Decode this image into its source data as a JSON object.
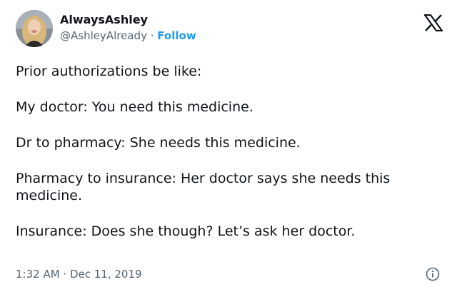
{
  "user": {
    "display_name": "AlwaysAshley",
    "handle": "@AshleyAlready",
    "separator": "·",
    "follow_label": "Follow"
  },
  "tweet": {
    "paragraphs": [
      "Prior authorizations be like:",
      "My doctor: You need this medicine.",
      "Dr to pharmacy: She needs this medicine.",
      "Pharmacy to insurance: Her doctor says she needs this medicine.",
      "Insurance: Does she though? Let’s ask her doctor."
    ],
    "timestamp": "1:32 AM · Dec 11, 2019"
  },
  "icons": {
    "brand": "x-logo-icon",
    "info": "info-icon",
    "avatar": "avatar"
  },
  "colors": {
    "text": "#0f1419",
    "secondary": "#536471",
    "accent": "#1d9bf0"
  }
}
